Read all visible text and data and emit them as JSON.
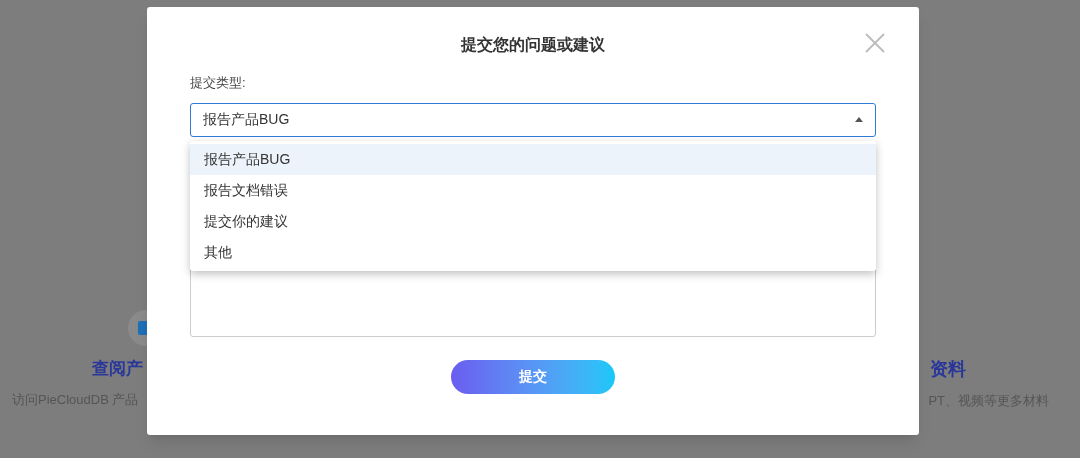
{
  "background": {
    "left": {
      "title": "查阅产",
      "description": "访问PieCloudDB 产品"
    },
    "right": {
      "title": "资料",
      "description": "PT、视频等更多材料"
    }
  },
  "dialog": {
    "title": "提交您的问题或建议",
    "type_label": "提交类型:",
    "select": {
      "value": "报告产品BUG",
      "expanded": true
    },
    "options": [
      {
        "label": "报告产品BUG",
        "selected": true
      },
      {
        "label": "报告文档错误",
        "selected": false
      },
      {
        "label": "提交你的建议",
        "selected": false
      },
      {
        "label": "其他",
        "selected": false
      }
    ],
    "submit": "提交"
  }
}
